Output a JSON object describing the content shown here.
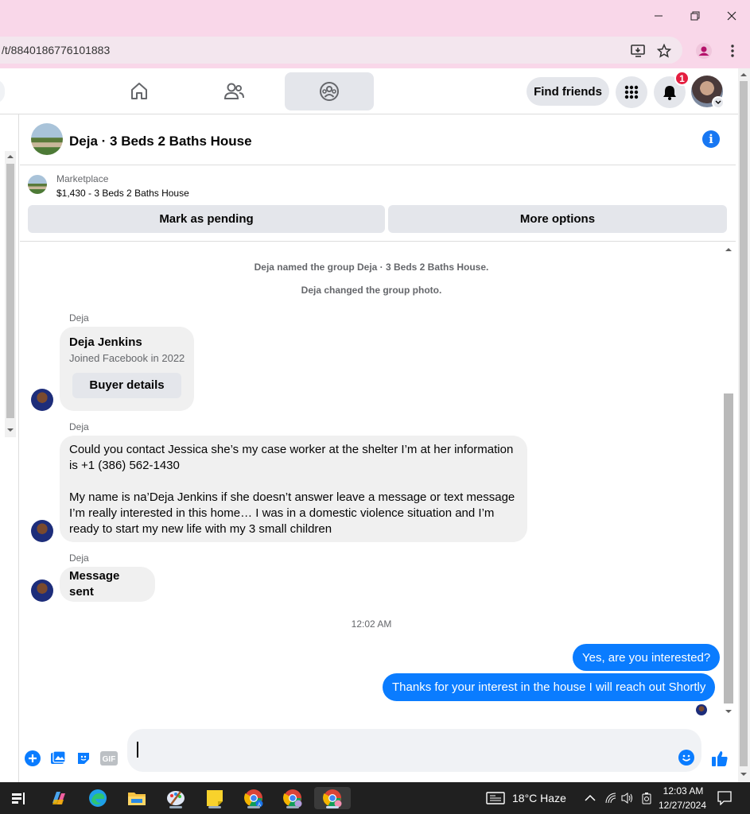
{
  "browser": {
    "url": "/t/8840186776101883",
    "window_controls": [
      "minimize",
      "restore",
      "close"
    ]
  },
  "nav": {
    "find_friends_label": "Find friends",
    "notification_count": "1"
  },
  "chat": {
    "title": "Deja · 3 Beds 2 Baths House",
    "marketplace_label": "Marketplace",
    "listing": "$1,430 - 3 Beds 2 Baths House",
    "mark_pending_label": "Mark as pending",
    "more_options_label": "More options"
  },
  "messages": {
    "system1": "Deja named the group Deja · 3 Beds 2 Baths House.",
    "system2": "Deja changed the group photo.",
    "sender": "Deja",
    "card_name": "Deja Jenkins",
    "card_sub": "Joined Facebook in 2022",
    "card_button": "Buyer details",
    "msg1_p1": "Could you contact Jessica she’s my case worker at the shelter I’m at her information is +1 (386) 562-1430",
    "msg1_p2": "My name is na’Deja Jenkins if she doesn’t answer leave a message or text message I’m really interested in this home… I was in a domestic violence situation and I’m ready to start my new life with my 3 small children",
    "msg2": "Message sent",
    "time": "12:02 AM",
    "out1": "Yes, are you interested?",
    "out2": "Thanks for your interest in the house I will reach out Shortly"
  },
  "taskbar": {
    "weather": "18°C  Haze",
    "time": "12:03 AM",
    "date": "12/27/2024"
  },
  "colors": {
    "accent": "#0a7cff",
    "fb_blue": "#1877f2",
    "titlebar": "#f9d7e9",
    "badge": "#e41e3f"
  }
}
